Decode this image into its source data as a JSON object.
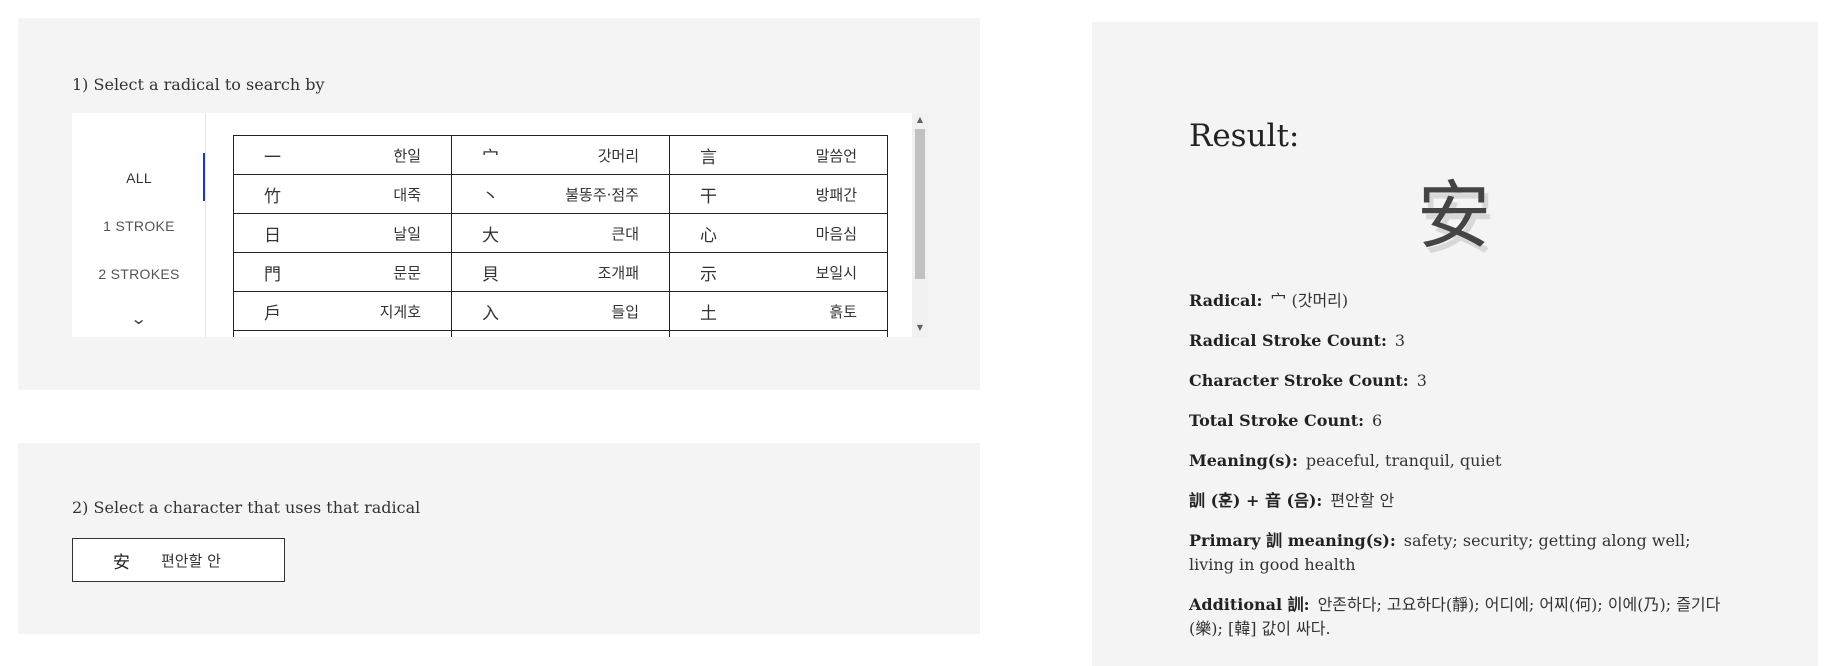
{
  "step1": {
    "heading": "1) Select a radical to search by",
    "stroke_tabs": [
      {
        "label": "ALL"
      },
      {
        "label": "1 STROKE"
      },
      {
        "label": "2 STROKES"
      }
    ],
    "radical_rows": [
      [
        {
          "char": "一",
          "name": "한일"
        },
        {
          "char": "宀",
          "name": "갓머리"
        },
        {
          "char": "言",
          "name": "말씀언"
        }
      ],
      [
        {
          "char": "竹",
          "name": "대죽"
        },
        {
          "char": "丶",
          "name": "불똥주·점주"
        },
        {
          "char": "干",
          "name": "방패간"
        }
      ],
      [
        {
          "char": "日",
          "name": "날일"
        },
        {
          "char": "大",
          "name": "큰대"
        },
        {
          "char": "心",
          "name": "마음심"
        }
      ],
      [
        {
          "char": "門",
          "name": "문문"
        },
        {
          "char": "貝",
          "name": "조개패"
        },
        {
          "char": "示",
          "name": "보일시"
        }
      ],
      [
        {
          "char": "戶",
          "name": "지게호"
        },
        {
          "char": "入",
          "name": "들입"
        },
        {
          "char": "土",
          "name": "흙토"
        }
      ]
    ]
  },
  "step2": {
    "heading": "2) Select a character that uses that radical",
    "options": [
      {
        "char": "安",
        "reading": "편안할 안"
      }
    ]
  },
  "result": {
    "title": "Result:",
    "character": "安",
    "fields": [
      {
        "label": "Radical:",
        "value": "宀 (갓머리)"
      },
      {
        "label": "Radical Stroke Count:",
        "value": "3"
      },
      {
        "label": "Character Stroke Count:",
        "value": "3"
      },
      {
        "label": "Total Stroke Count:",
        "value": "6"
      },
      {
        "label": "Meaning(s):",
        "value": "peaceful, tranquil, quiet"
      },
      {
        "label": "訓 (훈) + 音 (음):",
        "value": "편안할 안"
      },
      {
        "label": "Primary 訓 meaning(s):",
        "value": "safety; security; getting along well; living in good health"
      },
      {
        "label": "Additional 訓:",
        "value": "안존하다; 고요하다(靜); 어디에; 어찌(何); 이에(乃); 즐기다(樂); [韓] 값이 싸다."
      }
    ]
  },
  "colors": {
    "panel_bg": "#f4f4f4",
    "active_tab_bar": "#2233cc",
    "cell_border": "#222222"
  }
}
